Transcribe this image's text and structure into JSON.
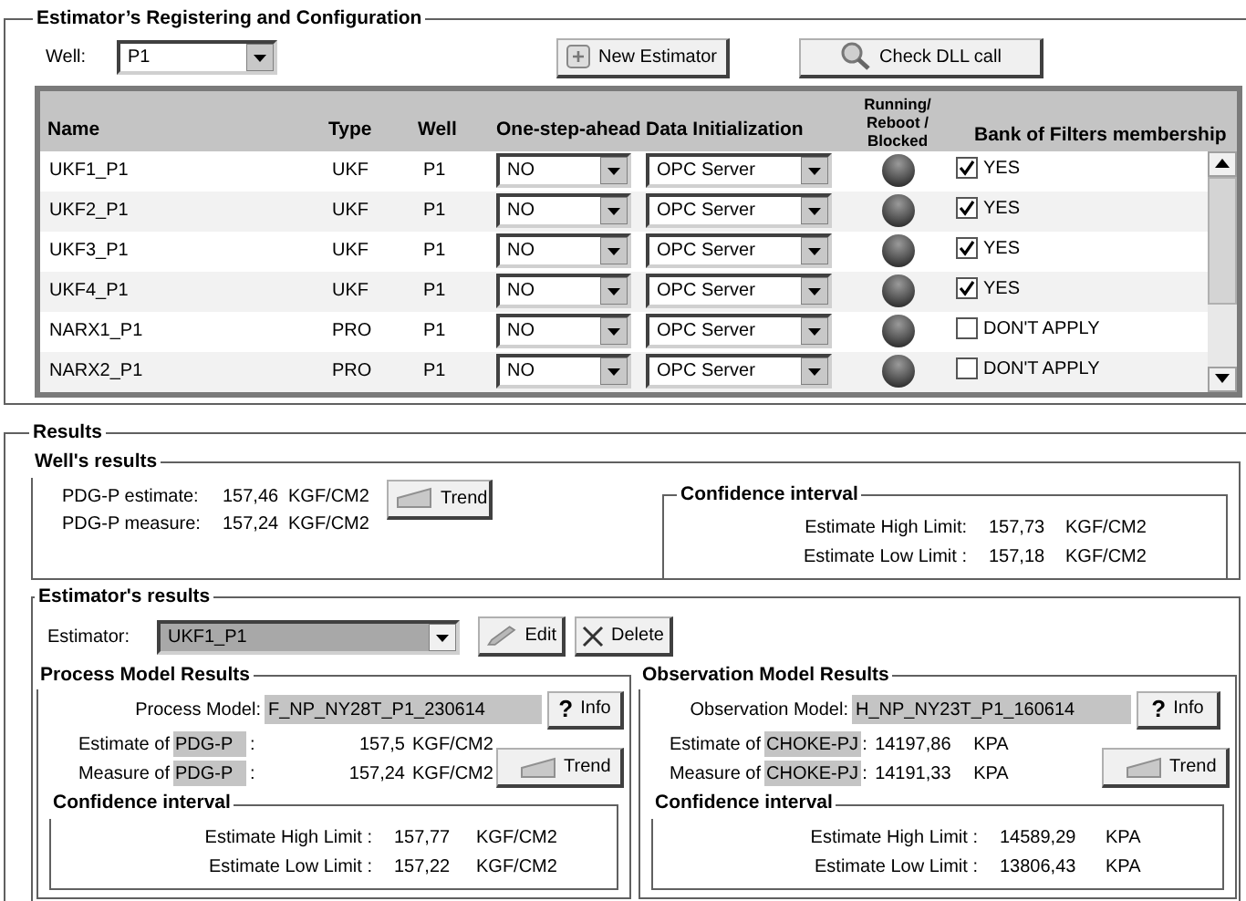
{
  "config": {
    "title": "Estimator’s Registering and Configuration",
    "well_label": "Well:",
    "well_value": "P1",
    "buttons": [
      {
        "kind": "new",
        "label": "New Estimator"
      },
      {
        "kind": "check",
        "label": "Check DLL call"
      }
    ],
    "table": {
      "columns": [
        "Name",
        "Type",
        "Well",
        "One-step-ahead",
        "Data Initialization",
        "Running/\nReboot  /\nBlocked",
        "Bank of Filters membership"
      ],
      "rows": [
        {
          "name": "UKF1_P1",
          "type": "UKF",
          "well": "P1",
          "one_step_ahead": "NO",
          "data_initialization": "OPC Server",
          "membership": "YES",
          "checked": true
        },
        {
          "name": "UKF2_P1",
          "type": "UKF",
          "well": "P1",
          "one_step_ahead": "NO",
          "data_initialization": "OPC Server",
          "membership": "YES",
          "checked": true
        },
        {
          "name": "UKF3_P1",
          "type": "UKF",
          "well": "P1",
          "one_step_ahead": "NO",
          "data_initialization": "OPC Server",
          "membership": "YES",
          "checked": true
        },
        {
          "name": "UKF4_P1",
          "type": "UKF",
          "well": "P1",
          "one_step_ahead": "NO",
          "data_initialization": "OPC Server",
          "membership": "YES",
          "checked": true
        },
        {
          "name": "NARX1_P1",
          "type": "PRO",
          "well": "P1",
          "one_step_ahead": "NO",
          "data_initialization": "OPC Server",
          "membership": "DON'T APPLY",
          "checked": false
        },
        {
          "name": "NARX2_P1",
          "type": "PRO",
          "well": "P1",
          "one_step_ahead": "NO",
          "data_initialization": "OPC Server",
          "membership": "DON'T APPLY",
          "checked": false
        }
      ]
    }
  },
  "results": {
    "title": "Results",
    "wells_results": {
      "title": "Well's results",
      "lines": [
        {
          "label": "PDG-P estimate:",
          "value": "157,46",
          "unit": "KGF/CM2"
        },
        {
          "label": "PDG-P measure:",
          "value": "157,24",
          "unit": "KGF/CM2"
        }
      ],
      "trend_button": "Trend",
      "confidence": {
        "title": "Confidence interval",
        "rows": [
          {
            "label": "Estimate High Limit:",
            "value": "157,73",
            "unit": "KGF/CM2"
          },
          {
            "label": "Estimate Low Limit :",
            "value": "157,18",
            "unit": "KGF/CM2"
          }
        ]
      }
    },
    "estimators_results": {
      "title": "Estimator's results",
      "estimator_label": "Estimator:",
      "estimator_value": "UKF1_P1",
      "buttons": [
        {
          "kind": "edit",
          "label": "Edit"
        },
        {
          "kind": "delete",
          "label": "Delete"
        }
      ],
      "panels": [
        {
          "title": "Process Model Results",
          "model_label": "Process Model:",
          "model_value": "F_NP_NY28T_P1_230614",
          "info_mark": "?",
          "info_label": "Info",
          "lines": [
            {
              "prefix": "Estimate of",
              "variable": "PDG-P",
              "separator": ":",
              "value": "157,5",
              "unit": "KGF/CM2"
            },
            {
              "prefix": "Measure of",
              "variable": "PDG-P",
              "separator": ":",
              "value": "157,24",
              "unit": "KGF/CM2"
            }
          ],
          "trend_button": "Trend",
          "confidence": {
            "title": "Confidence interval",
            "rows": [
              {
                "label": "Estimate High Limit :",
                "value": "157,77",
                "unit": "KGF/CM2"
              },
              {
                "label": "Estimate Low Limit :",
                "value": "157,22",
                "unit": "KGF/CM2"
              }
            ]
          }
        },
        {
          "title": "Observation Model Results",
          "model_label": "Observation Model:",
          "model_value": "H_NP_NY23T_P1_160614",
          "info_mark": "?",
          "info_label": "Info",
          "lines": [
            {
              "prefix": "Estimate of",
              "variable": "CHOKE-PJ",
              "separator": ":",
              "value": "14197,86",
              "unit": "KPA"
            },
            {
              "prefix": "Measure of",
              "variable": "CHOKE-PJ",
              "separator": ":",
              "value": "14191,33",
              "unit": "KPA"
            }
          ],
          "trend_button": "Trend",
          "confidence": {
            "title": "Confidence interval",
            "rows": [
              {
                "label": "Estimate High Limit :",
                "value": "14589,29",
                "unit": "KPA"
              },
              {
                "label": "Estimate Low Limit :",
                "value": "13806,43",
                "unit": "KPA"
              }
            ]
          }
        }
      ]
    }
  }
}
